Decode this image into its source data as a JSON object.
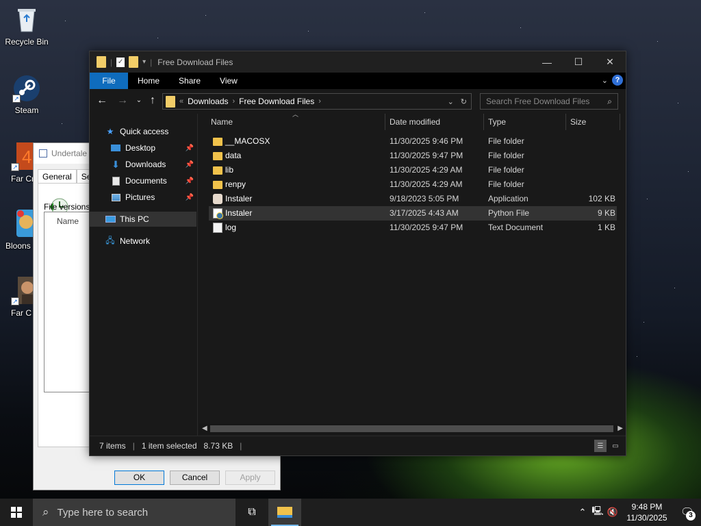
{
  "desktop": {
    "icons": [
      {
        "label": "Recycle Bin"
      },
      {
        "label": "Steam"
      },
      {
        "label": "Far Cr"
      },
      {
        "label": "Bloons"
      },
      {
        "label": "Far C"
      }
    ]
  },
  "properties_dialog": {
    "title": "Undertale",
    "tabs": [
      "General",
      "Sec"
    ],
    "file_versions_label": "File versions:",
    "list_header": "Name",
    "buttons": {
      "ok": "OK",
      "cancel": "Cancel",
      "apply": "Apply"
    }
  },
  "explorer": {
    "title": "Free Download Files",
    "ribbon_tabs": [
      "File",
      "Home",
      "Share",
      "View"
    ],
    "address": {
      "crumbs": [
        "Downloads",
        "Free Download Files"
      ]
    },
    "search_placeholder": "Search Free Download Files",
    "nav": {
      "quick_access": "Quick access",
      "items": [
        {
          "label": "Desktop",
          "icon": "desktop-icon"
        },
        {
          "label": "Downloads",
          "icon": "download-icon"
        },
        {
          "label": "Documents",
          "icon": "documents-icon"
        },
        {
          "label": "Pictures",
          "icon": "pictures-icon"
        }
      ],
      "this_pc": "This PC",
      "network": "Network"
    },
    "columns": {
      "name": "Name",
      "date": "Date modified",
      "type": "Type",
      "size": "Size"
    },
    "files": [
      {
        "name": "__MACOSX",
        "date": "11/30/2025 9:46 PM",
        "type": "File folder",
        "size": "",
        "icon": "folder"
      },
      {
        "name": "data",
        "date": "11/30/2025 9:47 PM",
        "type": "File folder",
        "size": "",
        "icon": "folder"
      },
      {
        "name": "lib",
        "date": "11/30/2025 4:29 AM",
        "type": "File folder",
        "size": "",
        "icon": "folder"
      },
      {
        "name": "renpy",
        "date": "11/30/2025 4:29 AM",
        "type": "File folder",
        "size": "",
        "icon": "folder"
      },
      {
        "name": "Instaler",
        "date": "9/18/2023 5:05 PM",
        "type": "Application",
        "size": "102 KB",
        "icon": "app"
      },
      {
        "name": "Instaler",
        "date": "3/17/2025 4:43 AM",
        "type": "Python File",
        "size": "9 KB",
        "icon": "python"
      },
      {
        "name": "log",
        "date": "11/30/2025 9:47 PM",
        "type": "Text Document",
        "size": "1 KB",
        "icon": "text"
      }
    ],
    "selected_index": 5,
    "status": {
      "items": "7 items",
      "selected": "1 item selected",
      "size": "8.73 KB"
    }
  },
  "taskbar": {
    "search_placeholder": "Type here to search",
    "time": "9:48 PM",
    "date": "11/30/2025",
    "notification_count": "3"
  }
}
